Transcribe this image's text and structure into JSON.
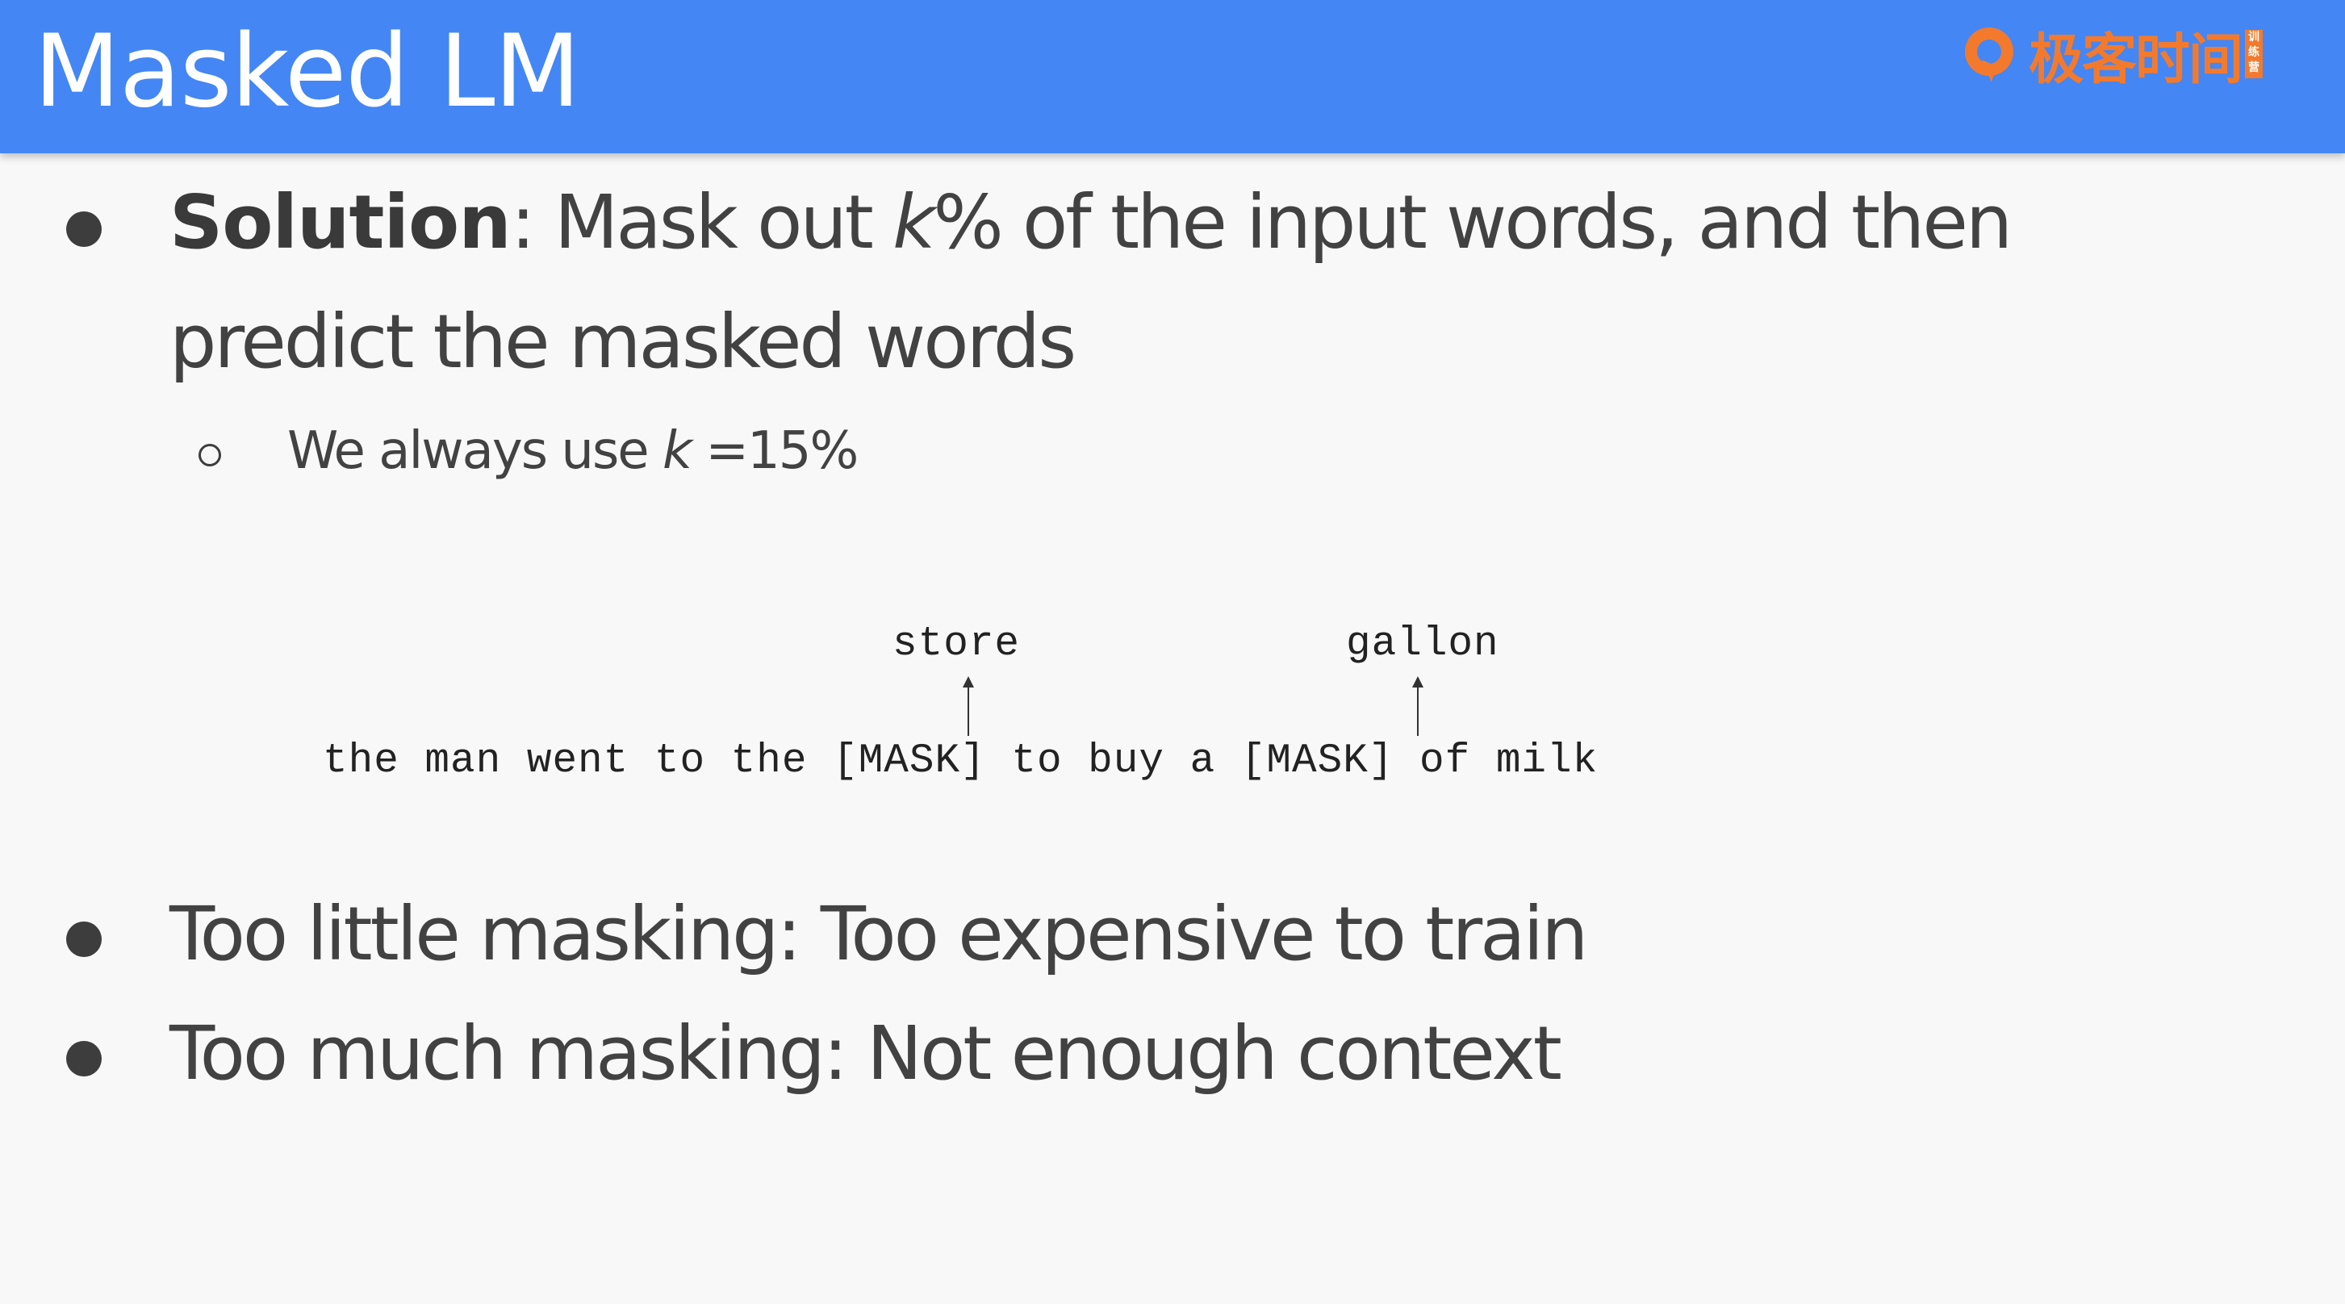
{
  "slide": {
    "title": "Masked LM",
    "logo": {
      "text": "极客时间",
      "badge": "训练营",
      "icon": "geektime-logo-icon"
    },
    "bullets": [
      {
        "bold": "Solution",
        "line1_rest_a": ": Mask out ",
        "line1_ital": "k",
        "line1_rest_b": "% of the input words, and  then",
        "line2": "predict the masked words"
      }
    ],
    "sub_bullet": {
      "text_a": "We always use ",
      "ital": "k",
      "text_b": " =15%"
    },
    "example": {
      "sentence": "the man went to the [MASK] to buy a [MASK] of milk",
      "prediction_1": "store",
      "prediction_2": "gallon"
    },
    "bullet_2": "Too little masking: Too expensive to  train",
    "bullet_3": "Too much masking: Not enough context"
  },
  "colors": {
    "header_bg": "#4486f4",
    "slide_bg": "#f8f8f8",
    "logo_orange": "#f37a2c",
    "text": "#424242"
  }
}
